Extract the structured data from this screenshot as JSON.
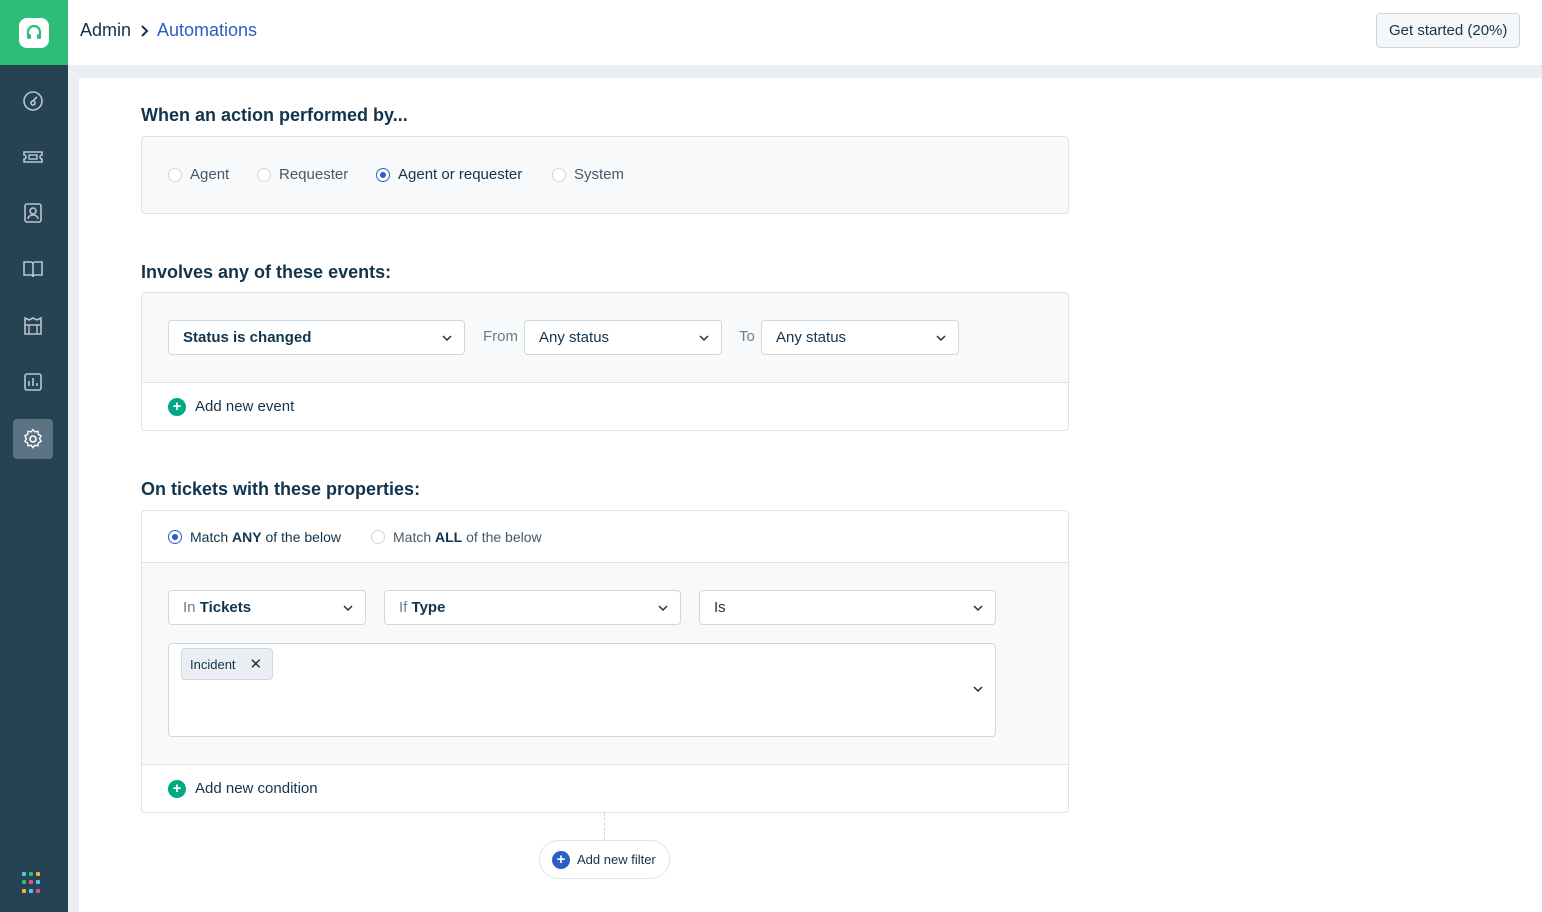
{
  "header": {
    "breadcrumb_root": "Admin",
    "breadcrumb_current": "Automations",
    "get_started_label": "Get started (20%)"
  },
  "sidebar": {
    "items": [
      {
        "icon": "dashboard-icon"
      },
      {
        "icon": "ticket-icon"
      },
      {
        "icon": "contacts-icon"
      },
      {
        "icon": "knowledge-base-icon"
      },
      {
        "icon": "assets-icon"
      },
      {
        "icon": "reports-icon"
      },
      {
        "icon": "gear-icon",
        "active": true
      }
    ]
  },
  "performed_by": {
    "title": "When an action performed by...",
    "options": [
      "Agent",
      "Requester",
      "Agent or requester",
      "System"
    ],
    "selected": "Agent or requester"
  },
  "events": {
    "title": "Involves any of these events:",
    "event_select": "Status is changed",
    "from_label": "From",
    "from_value": "Any status",
    "to_label": "To",
    "to_value": "Any status",
    "add_event_label": "Add new event"
  },
  "properties": {
    "title": "On tickets with these properties:",
    "match_any": {
      "prefix": "Match ",
      "bold": "ANY",
      "suffix": " of the below"
    },
    "match_all": {
      "prefix": "Match ",
      "bold": "ALL",
      "suffix": " of the below"
    },
    "selected_match": "ANY",
    "condition": {
      "in_prefix": "In ",
      "in_value": "Tickets",
      "if_prefix": "If ",
      "if_value": "Type",
      "operator": "Is",
      "values": [
        "Incident"
      ]
    },
    "add_condition_label": "Add new condition",
    "add_filter_label": "Add new filter"
  },
  "colors": {
    "brand_green": "#2ebd78",
    "sidebar_bg": "#264354",
    "link_blue": "#2c5cc5",
    "add_green": "#00a886"
  }
}
